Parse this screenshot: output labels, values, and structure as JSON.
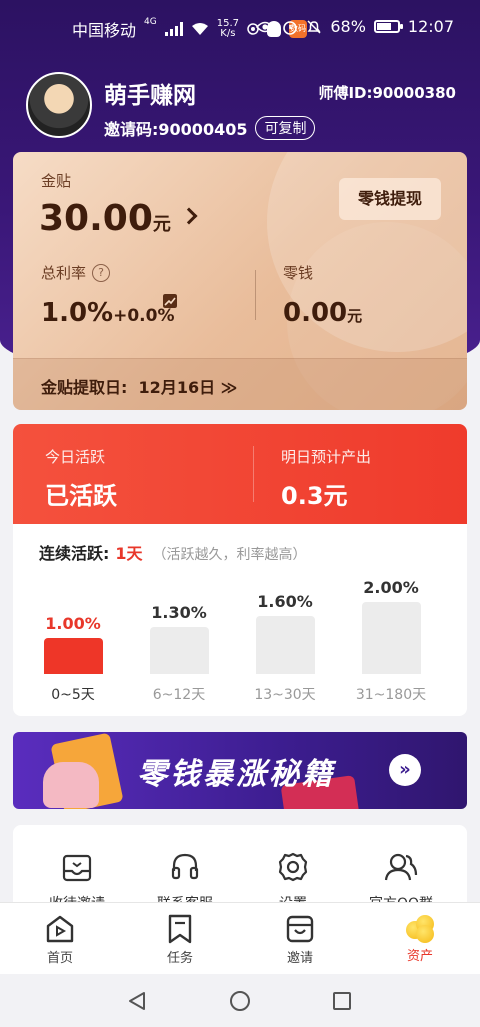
{
  "status_bar": {
    "carrier": "中国移动",
    "network": "4G",
    "speed_value": "15.7",
    "speed_unit": "K/s",
    "app_badge": "数码",
    "battery": "68%",
    "time": "12:07"
  },
  "profile": {
    "name": "萌手赚网",
    "invite_label": "邀请码:",
    "invite_code": "90000405",
    "copy_label": "可复制",
    "master_label": "师傅ID:",
    "master_id": "90000380"
  },
  "gold_card": {
    "label": "金贴",
    "amount": "30.00",
    "amount_unit": "元",
    "withdraw_label": "零钱提现",
    "rate_label": "总利率",
    "rate_help": "?",
    "rate_value": "1.0%",
    "rate_extra": "+0.0%",
    "change_label": "零钱",
    "change_value": "0.00",
    "change_unit": "元",
    "withdraw_day_label": "金贴提取日:",
    "withdraw_day": "12月16日",
    "withdraw_day_arrow": "≫"
  },
  "activity": {
    "today_label": "今日活跃",
    "today_value": "已活跃",
    "tomorrow_label": "明日预计产出",
    "tomorrow_value": "0.3元",
    "streak_label": "连续活跃:",
    "streak_days": "1天",
    "streak_hint": "（活跃越久，利率越高）"
  },
  "chart_data": {
    "type": "bar",
    "categories": [
      "0~5天",
      "6~12天",
      "13~30天",
      "31~180天"
    ],
    "values": [
      1.0,
      1.3,
      1.6,
      2.0
    ],
    "labels": [
      "1.00%",
      "1.30%",
      "1.60%",
      "2.00%"
    ],
    "active_index": 0,
    "ylim": [
      0,
      2.0
    ],
    "active_color": "#ee3628",
    "inactive_color": "#ececec"
  },
  "banner": {
    "text": "零钱暴涨秘籍",
    "button": "»"
  },
  "tools": [
    {
      "label": "收徒邀请",
      "icon": "inbox-icon"
    },
    {
      "label": "联系客服",
      "icon": "headset-icon"
    },
    {
      "label": "设置",
      "icon": "gear-icon"
    },
    {
      "label": "官方QQ群",
      "icon": "group-icon"
    }
  ],
  "tabbar": [
    {
      "label": "首页",
      "icon": "home-icon",
      "active": false
    },
    {
      "label": "任务",
      "icon": "bookmark-icon",
      "active": false
    },
    {
      "label": "邀请",
      "icon": "invite-icon",
      "active": false
    },
    {
      "label": "资产",
      "icon": "coins-icon",
      "active": true
    }
  ],
  "colors": {
    "header": "#3a1778",
    "accent_red": "#e8372a",
    "gold_text": "#3f1d0c"
  }
}
